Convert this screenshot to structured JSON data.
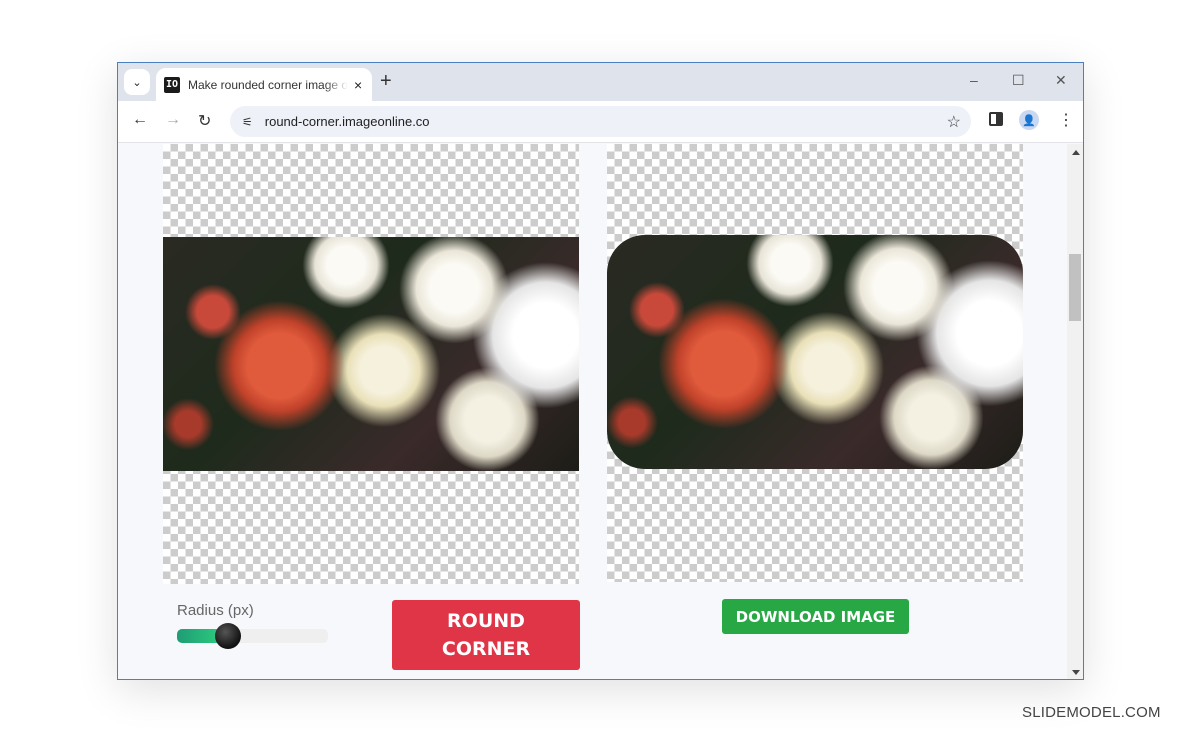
{
  "browser": {
    "tab": {
      "favicon_text": "IO",
      "title": "Make rounded corner image online",
      "close_icon": "×"
    },
    "tab_search_icon": "⌄",
    "new_tab_icon": "+",
    "window_controls": {
      "minimize": "–",
      "maximize": "☐",
      "close": "✕"
    },
    "nav": {
      "back": "←",
      "forward": "→",
      "reload": "↻"
    },
    "site_info_icon": "⚟",
    "url": "round-corner.imageonline.co",
    "bookmark_icon": "☆",
    "profile_icon": "👤",
    "menu_icon": "⋮"
  },
  "page": {
    "left_panel": {
      "description": "original image preview"
    },
    "right_panel": {
      "description": "rounded corner result preview"
    },
    "radius": {
      "label": "Radius (px)",
      "value_fraction": 0.34
    },
    "round_button_label": "ROUND CORNER",
    "download_button_label": "DOWNLOAD IMAGE"
  },
  "colors": {
    "round_button": "#e03447",
    "download_button": "#28a745",
    "slider_fill": "#2ed27f"
  },
  "watermark": "SLIDEMODEL.COM"
}
